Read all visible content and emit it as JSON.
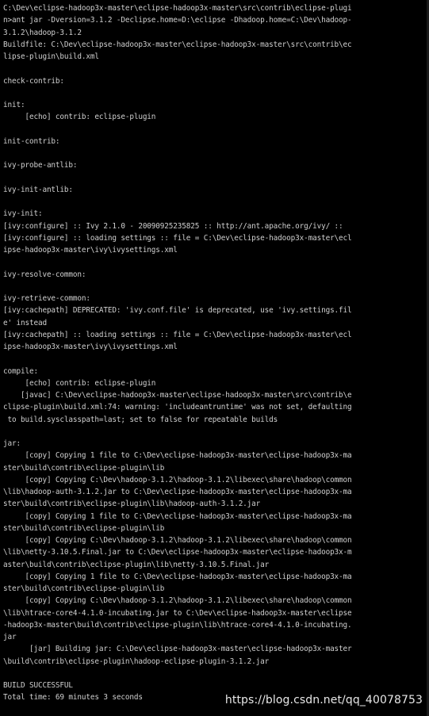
{
  "console": {
    "lines": [
      "C:\\Dev\\eclipse-hadoop3x-master\\eclipse-hadoop3x-master\\src\\contrib\\eclipse-plugi",
      "n>ant jar -Dversion=3.1.2 -Declipse.home=D:\\eclipse -Dhadoop.home=C:\\Dev\\hadoop-",
      "3.1.2\\hadoop-3.1.2",
      "Buildfile: C:\\Dev\\eclipse-hadoop3x-master\\eclipse-hadoop3x-master\\src\\contrib\\ec",
      "lipse-plugin\\build.xml",
      "",
      "check-contrib:",
      "",
      "init:",
      "     [echo] contrib: eclipse-plugin",
      "",
      "init-contrib:",
      "",
      "ivy-probe-antlib:",
      "",
      "ivy-init-antlib:",
      "",
      "ivy-init:",
      "[ivy:configure] :: Ivy 2.1.0 - 20090925235825 :: http://ant.apache.org/ivy/ ::",
      "[ivy:configure] :: loading settings :: file = C:\\Dev\\eclipse-hadoop3x-master\\ecl",
      "ipse-hadoop3x-master\\ivy\\ivysettings.xml",
      "",
      "ivy-resolve-common:",
      "",
      "ivy-retrieve-common:",
      "[ivy:cachepath] DEPRECATED: 'ivy.conf.file' is deprecated, use 'ivy.settings.fil",
      "e' instead",
      "[ivy:cachepath] :: loading settings :: file = C:\\Dev\\eclipse-hadoop3x-master\\ecl",
      "ipse-hadoop3x-master\\ivy\\ivysettings.xml",
      "",
      "compile:",
      "     [echo] contrib: eclipse-plugin",
      "    [javac] C:\\Dev\\eclipse-hadoop3x-master\\eclipse-hadoop3x-master\\src\\contrib\\e",
      "clipse-plugin\\build.xml:74: warning: 'includeantruntime' was not set, defaulting",
      " to build.sysclasspath=last; set to false for repeatable builds",
      "",
      "jar:",
      "     [copy] Copying 1 file to C:\\Dev\\eclipse-hadoop3x-master\\eclipse-hadoop3x-ma",
      "ster\\build\\contrib\\eclipse-plugin\\lib",
      "     [copy] Copying C:\\Dev\\hadoop-3.1.2\\hadoop-3.1.2\\libexec\\share\\hadoop\\common",
      "\\lib\\hadoop-auth-3.1.2.jar to C:\\Dev\\eclipse-hadoop3x-master\\eclipse-hadoop3x-ma",
      "ster\\build\\contrib\\eclipse-plugin\\lib\\hadoop-auth-3.1.2.jar",
      "     [copy] Copying 1 file to C:\\Dev\\eclipse-hadoop3x-master\\eclipse-hadoop3x-ma",
      "ster\\build\\contrib\\eclipse-plugin\\lib",
      "     [copy] Copying C:\\Dev\\hadoop-3.1.2\\hadoop-3.1.2\\libexec\\share\\hadoop\\common",
      "\\lib\\netty-3.10.5.Final.jar to C:\\Dev\\eclipse-hadoop3x-master\\eclipse-hadoop3x-m",
      "aster\\build\\contrib\\eclipse-plugin\\lib\\netty-3.10.5.Final.jar",
      "     [copy] Copying 1 file to C:\\Dev\\eclipse-hadoop3x-master\\eclipse-hadoop3x-ma",
      "ster\\build\\contrib\\eclipse-plugin\\lib",
      "     [copy] Copying C:\\Dev\\hadoop-3.1.2\\hadoop-3.1.2\\libexec\\share\\hadoop\\common",
      "\\lib\\htrace-core4-4.1.0-incubating.jar to C:\\Dev\\eclipse-hadoop3x-master\\eclipse",
      "-hadoop3x-master\\build\\contrib\\eclipse-plugin\\lib\\htrace-core4-4.1.0-incubating.",
      "jar",
      "      [jar] Building jar: C:\\Dev\\eclipse-hadoop3x-master\\eclipse-hadoop3x-master",
      "\\build\\contrib\\eclipse-plugin\\hadoop-eclipse-plugin-3.1.2.jar",
      "",
      "BUILD SUCCESSFUL",
      "Total time: 69 minutes 3 seconds"
    ]
  },
  "watermark": {
    "text": "https://blog.csdn.net/qq_40078753"
  },
  "colors": {
    "background": "#000000",
    "text": "#cfcfcf",
    "watermark": "#e8e8e8"
  }
}
